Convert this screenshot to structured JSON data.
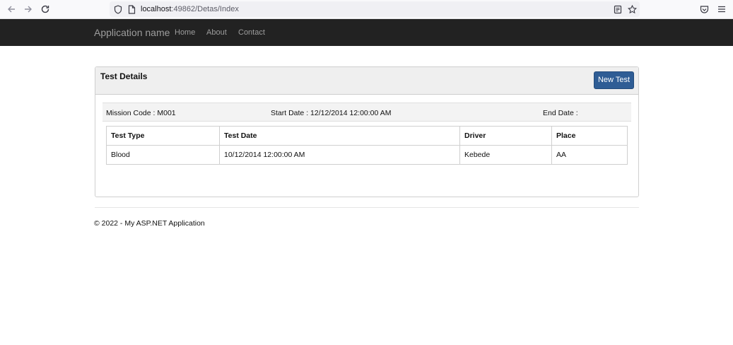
{
  "browser": {
    "url_host": "localhost",
    "url_path": ":49862/Detas/Index"
  },
  "navbar": {
    "brand": "Application name",
    "links": [
      "Home",
      "About",
      "Contact"
    ]
  },
  "panel": {
    "title": "Test Details",
    "new_button": "New Test",
    "mission_code": "Mission Code : M001",
    "start_date": "Start Date : 12/12/2014 12:00:00 AM",
    "end_date": "End Date :"
  },
  "table": {
    "headers": [
      "Test Type",
      "Test Date",
      "Driver",
      "Place"
    ],
    "rows": [
      [
        "Blood",
        "10/12/2014 12:00:00 AM",
        "Kebede",
        "AA"
      ]
    ]
  },
  "footer": "© 2022 - My ASP.NET Application",
  "colors": {
    "navbar_bg": "#222222",
    "button_primary": "#2f5d95"
  }
}
